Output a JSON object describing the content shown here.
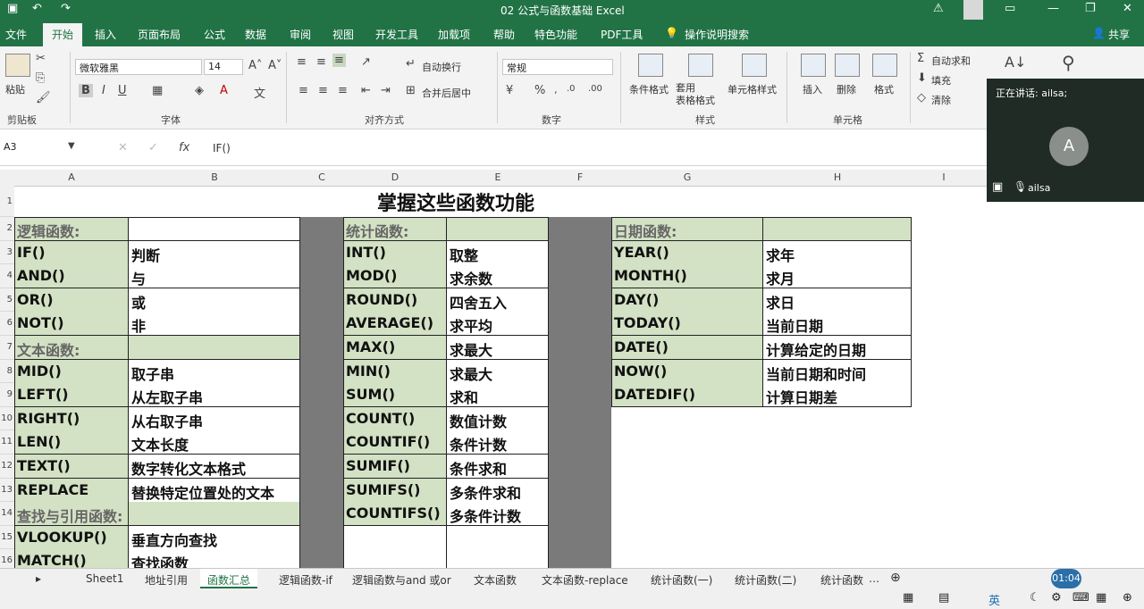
{
  "titlebar": {
    "title": "02 公式与函数基础 Excel"
  },
  "tabs": [
    "文件",
    "开始",
    "插入",
    "页面布局",
    "公式",
    "数据",
    "审阅",
    "视图",
    "开发工具",
    "加载项",
    "帮助",
    "特色功能",
    "PDF工具",
    "操作说明搜索"
  ],
  "share_label": "共享",
  "ribbon": {
    "paste": "粘贴",
    "clipboard": "剪贴板",
    "font_name": "微软雅黑",
    "font_size": "14",
    "font_group": "字体",
    "wrap_text": "自动换行",
    "merge_center": "合并后居中",
    "align_group": "对齐方式",
    "number_format": "常规",
    "number_group": "数字",
    "cond_format": "条件格式",
    "table_format": "套用\n表格格式",
    "cell_styles": "单元格样式",
    "styles_group": "样式",
    "insert": "插入",
    "delete": "删除",
    "format": "格式",
    "cells_group": "单元格",
    "autosum": "自动求和",
    "fill": "填充",
    "clear": "清除"
  },
  "formula_bar": {
    "name_box": "A3",
    "content": "IF()"
  },
  "columns": [
    "A",
    "B",
    "C",
    "D",
    "E",
    "F",
    "G",
    "H",
    "I"
  ],
  "rows": [
    "1",
    "2",
    "3",
    "4",
    "5",
    "6",
    "7",
    "8",
    "9",
    "10",
    "11",
    "12",
    "13",
    "14",
    "15",
    "16"
  ],
  "sheet_title": "掌握这些函数功能",
  "logic": {
    "header": "逻辑函数:",
    "items": [
      {
        "f": "IF()",
        "d": "判断"
      },
      {
        "f": "AND()",
        "d": "与"
      },
      {
        "f": "OR()",
        "d": "或"
      },
      {
        "f": "NOT()",
        "d": "非"
      }
    ],
    "text_header": "文本函数:",
    "text_items": [
      {
        "f": "MID()",
        "d": "取子串"
      },
      {
        "f": "LEFT()",
        "d": "从左取子串"
      },
      {
        "f": "RIGHT()",
        "d": "从右取子串"
      },
      {
        "f": "LEN()",
        "d": "文本长度"
      },
      {
        "f": "TEXT()",
        "d": "数字转化文本格式"
      },
      {
        "f": "REPLACE",
        "d": "替换特定位置处的文本"
      }
    ],
    "lookup_header": "查找与引用函数:",
    "lookup_items": [
      {
        "f": "VLOOKUP()",
        "d": "垂直方向查找"
      },
      {
        "f": "MATCH()",
        "d": "查找函数"
      }
    ]
  },
  "stats": {
    "header": "统计函数:",
    "items": [
      {
        "f": "INT()",
        "d": "取整"
      },
      {
        "f": "MOD()",
        "d": "求余数"
      },
      {
        "f": "ROUND()",
        "d": "四舍五入"
      },
      {
        "f": "AVERAGE()",
        "d": "求平均"
      },
      {
        "f": "MAX()",
        "d": "求最大"
      },
      {
        "f": "MIN()",
        "d": "求最大"
      },
      {
        "f": "SUM()",
        "d": "求和"
      },
      {
        "f": "COUNT()",
        "d": "数值计数"
      },
      {
        "f": "COUNTIF()",
        "d": "条件计数"
      },
      {
        "f": "SUMIF()",
        "d": "条件求和"
      },
      {
        "f": "SUMIFS()",
        "d": "多条件求和"
      },
      {
        "f": "COUNTIFS()",
        "d": "多条件计数"
      }
    ]
  },
  "dates": {
    "header": "日期函数:",
    "items": [
      {
        "f": "YEAR()",
        "d": "求年"
      },
      {
        "f": "MONTH()",
        "d": "求月"
      },
      {
        "f": "DAY()",
        "d": "求日"
      },
      {
        "f": "TODAY()",
        "d": "当前日期"
      },
      {
        "f": "DATE()",
        "d": "计算给定的日期"
      },
      {
        "f": "NOW()",
        "d": "当前日期和时间"
      },
      {
        "f": "DATEDIF()",
        "d": "计算日期差"
      }
    ]
  },
  "sheet_tabs": [
    "Sheet1",
    "地址引用",
    "函数汇总",
    "逻辑函数-if",
    "逻辑函数与and 或or",
    "文本函数",
    "文本函数-replace",
    "统计函数(一)",
    "统计函数(二)",
    "统计函数"
  ],
  "active_sheet": "函数汇总",
  "meeting": {
    "speaking": "正在讲话: ailsa;",
    "avatar_letter": "A",
    "user": "ailsa"
  },
  "timer": "01:04",
  "ime": "英"
}
